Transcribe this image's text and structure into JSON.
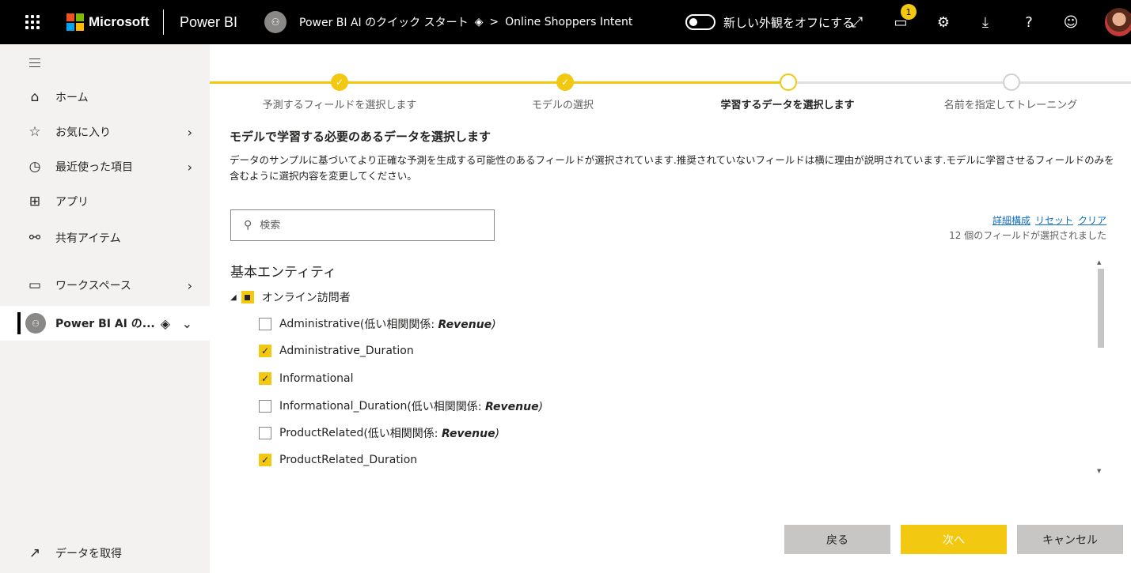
{
  "topbar": {
    "brand": "Microsoft",
    "app_name": "Power BI",
    "workspace_name": "Power BI AI のクイック スタート",
    "crumb_separator": ">",
    "dataset": "Online Shoppers Intent",
    "toggle_label": "新しい外観をオフにする",
    "notification_count": "1",
    "ms_colors": [
      "#f25022",
      "#7fba00",
      "#00a4ef",
      "#ffb900"
    ]
  },
  "sidebar": {
    "items": [
      {
        "label": "ホーム",
        "icon": "home-icon"
      },
      {
        "label": "お気に入り",
        "icon": "star-icon"
      },
      {
        "label": "最近使った項目",
        "icon": "clock-icon"
      },
      {
        "label": "アプリ",
        "icon": "apps-icon"
      },
      {
        "label": "共有アイテム",
        "icon": "shared-icon"
      },
      {
        "label": "ワークスペース",
        "icon": "workspaces-icon"
      },
      {
        "label": "Power BI AI の...",
        "icon": "workspace-icon"
      }
    ],
    "get_data": "データを取得"
  },
  "stepper": {
    "steps": [
      {
        "label": "予測するフィールドを選択します",
        "state": "done"
      },
      {
        "label": "モデルの選択",
        "state": "done"
      },
      {
        "label": "学習するデータを選択します",
        "state": "current"
      },
      {
        "label": "名前を指定してトレーニング",
        "state": "future"
      }
    ],
    "accent": "#f2c811"
  },
  "main": {
    "title": "モデルで学習する必要のあるデータを選択します",
    "description": "データのサンプルに基づいてより正確な予測を生成する可能性のあるフィールドが選択されています.推奨されていないフィールドは横に理由が説明されています.モデルに学習させるフィールドのみを含むように選択内容を変更してください。",
    "search_placeholder": "検索",
    "links": {
      "advanced": "詳細構成",
      "reset": "リセット",
      "clear": "クリア"
    },
    "selected_count": "12 個のフィールドが選択されました",
    "entity_section_title": "基本エンティティ",
    "entity_name": "オンライン訪問者",
    "fields": [
      {
        "name": "Administrative",
        "checked": false,
        "reason_prefix": " (低い相関関係: ",
        "reason_field": "Revenue",
        "reason_suffix": ")"
      },
      {
        "name": "Administrative_Duration",
        "checked": true
      },
      {
        "name": "Informational",
        "checked": true
      },
      {
        "name": "Informational_Duration",
        "checked": false,
        "reason_prefix": " (低い相関関係: ",
        "reason_field": "Revenue",
        "reason_suffix": ")"
      },
      {
        "name": "ProductRelated",
        "checked": false,
        "reason_prefix": " (低い相関関係: ",
        "reason_field": "Revenue",
        "reason_suffix": ")"
      },
      {
        "name": "ProductRelated_Duration",
        "checked": true
      }
    ]
  },
  "footer": {
    "back": "戻る",
    "next": "次へ",
    "cancel": "キャンセル"
  }
}
